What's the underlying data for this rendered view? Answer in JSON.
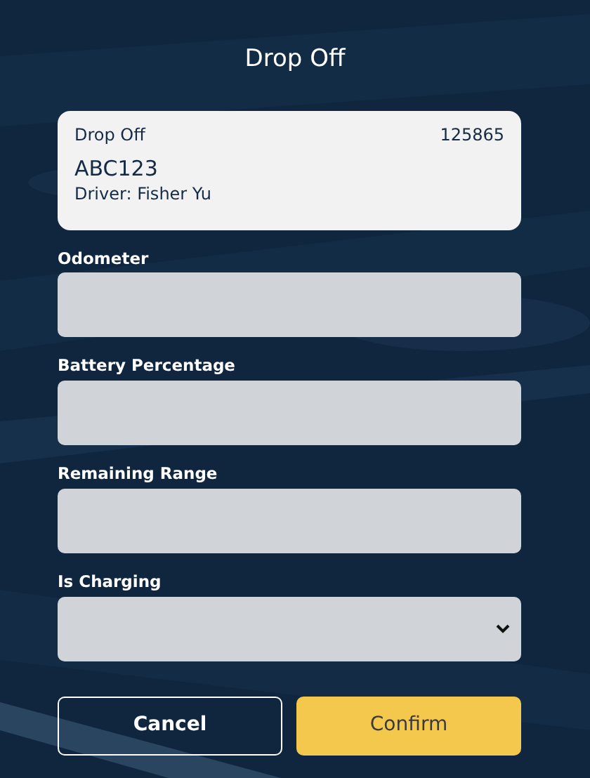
{
  "title": "Drop Off",
  "booking": {
    "type": "Drop Off",
    "number": "125865",
    "plate": "ABC123",
    "driver": "Driver: Fisher Yu"
  },
  "fields": [
    {
      "label": "Odometer",
      "kind": "text"
    },
    {
      "label": "Battery Percentage",
      "kind": "text"
    },
    {
      "label": "Remaining Range",
      "kind": "text"
    },
    {
      "label": "Is Charging",
      "kind": "select"
    }
  ],
  "buttons": [
    {
      "label": "Cancel",
      "kind": "secondary"
    },
    {
      "label": "Confirm",
      "kind": "primary"
    }
  ]
}
